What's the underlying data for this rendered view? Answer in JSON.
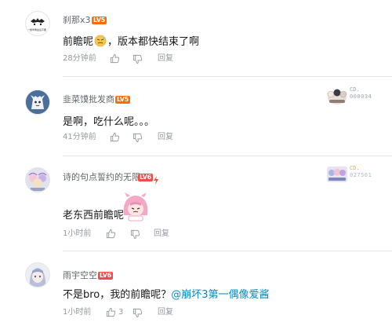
{
  "comments": [
    {
      "username": "刹那x3",
      "level": "LV5",
      "text": "前瞻呢",
      "text_after_emoji": "，版本都快结束了啊",
      "time": "28分钟前",
      "like_count": "",
      "reply": "回复",
      "avatar_caption": "一根羊角最后不要"
    },
    {
      "username": "韭菜馍批发商",
      "level": "LV5",
      "text": "是啊，吃什么呢。。。",
      "time": "41分钟前",
      "like_count": "",
      "reply": "回复",
      "fan_badge": {
        "label": "CD.",
        "number": "000034"
      }
    },
    {
      "username": "诗的句点誓约的无限",
      "level": "LV6",
      "text": "老东西前瞻呢",
      "time": "1小时前",
      "like_count": "",
      "reply": "回复",
      "fan_badge": {
        "label": "CD.",
        "number": "027561"
      }
    },
    {
      "username": "雨宇空空",
      "level": "LV6",
      "text": "不是bro，我的前瞻呢？",
      "mention": "@崩坏3第一偶像爱酱",
      "time": "1小时前",
      "like_count": "3",
      "reply": "回复"
    }
  ],
  "colors": {
    "username": "#61666d",
    "text": "#18191c",
    "meta": "#9499a0",
    "mention": "#008ac5",
    "lv5": "#ff6c00",
    "lv6": "#f04c49"
  }
}
